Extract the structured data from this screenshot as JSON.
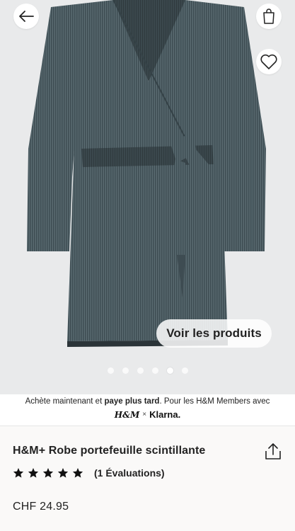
{
  "hero": {
    "cta_label": "Voir les produits",
    "slides_count": 6,
    "active_slide": 5
  },
  "nav": {
    "back_icon": "arrow-left-icon",
    "bag_icon": "shopping-bag-icon",
    "favorite_icon": "heart-icon"
  },
  "klarna_banner": {
    "text_prefix": "Achète maintenant et ",
    "text_bold": "paye plus tard",
    "text_suffix": ". Pour les H&M Members avec",
    "hm_logo": "H&M",
    "times": "×",
    "klarna_logo": "Klarna."
  },
  "product": {
    "title": "H&M+ Robe portefeuille scintillante",
    "rating_stars": 5,
    "rating_count_label": "(1 Évaluations)",
    "price": "CHF 24.95",
    "share_icon": "share-icon"
  },
  "colors": {
    "dress": "#4a5a60",
    "hero_bg": "#e9eaeb",
    "text": "#222222"
  }
}
